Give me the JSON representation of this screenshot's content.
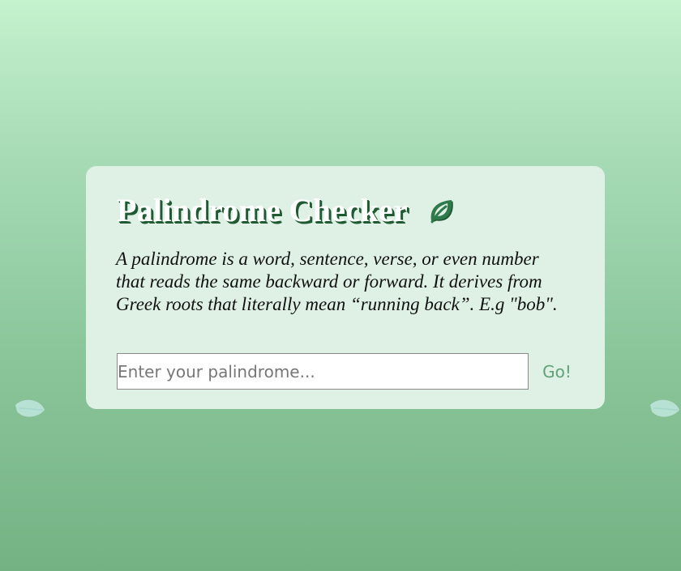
{
  "app": {
    "title": "Palindrome Checker",
    "title_icon": "leaf-icon",
    "description": "A palindrome is a word, sentence, verse, or even number that reads the same backward or forward. It derives from Greek roots that literally mean “running back”. E.g \"bob\".",
    "input": {
      "placeholder": "Enter your palindrome...",
      "value": ""
    },
    "submit_label": "Go!"
  },
  "colors": {
    "background_top": "#c4f2cd",
    "background_bottom": "#74b284",
    "card": "#dff0e4",
    "title_shadow": "#1f5a33",
    "button_text": "#5fa277"
  },
  "decor": {
    "left_icon": "leaf-icon",
    "right_icon": "leaf-icon"
  }
}
